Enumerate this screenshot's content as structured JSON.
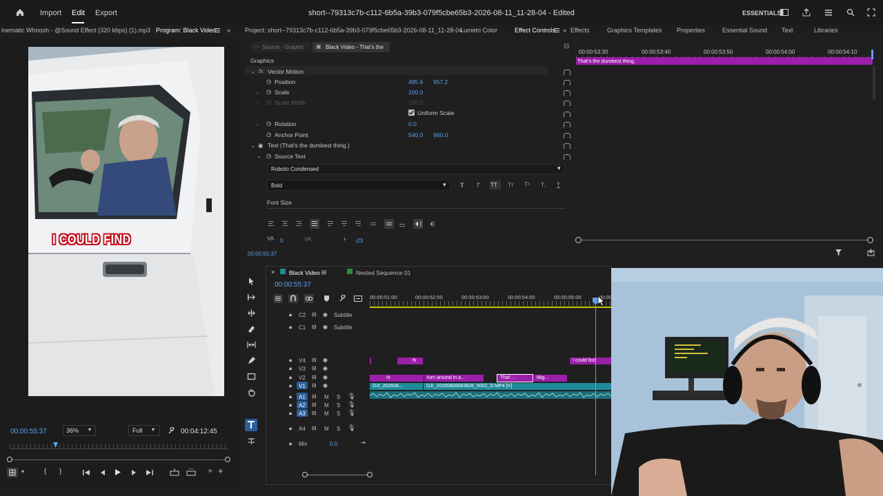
{
  "topbar": {
    "menu": [
      "Import",
      "Edit",
      "Export"
    ],
    "active_menu": "Edit",
    "title": "short--79313c7b-c112-6b5a-39b3-079f5cbe65b3-2026-08-11_11-28-04 - Edited",
    "workspace": "ESSENTIALS"
  },
  "panels": {
    "left_audio_tab": "inematic Whoosh - @Sound Effect (320 kbps) (1).mp3",
    "program_tab": "Program: Black Video",
    "project_tab": "Project: short--79313c7b-c112-6b5a-39b3-079f5cbe65b3-2026-08-11_11-28-04",
    "lumetri_tab": "Lumetri Color",
    "effect_controls_tab": "Effect Controls",
    "right_tabs": [
      "Effects",
      "Graphics Templates",
      "Properties",
      "Essential Sound",
      "Text",
      "Libraries"
    ]
  },
  "program": {
    "caption": "I COULD FIND",
    "timecode": "00:00:55:37",
    "zoom": "36%",
    "quality": "Full",
    "duration": "00:04:12:45",
    "playhead_fraction": 0.22
  },
  "effect_controls": {
    "source_tab": "Source - Graphic",
    "clip_tab": "Black Video - That's the",
    "section": "Graphics",
    "vector_motion": "Vector Motion",
    "position_label": "Position",
    "position_x": "495.6",
    "position_y": "957.2",
    "scale_label": "Scale",
    "scale_value": "100.0",
    "scale_width_label": "Scale Width",
    "scale_width_value": "100.0",
    "uniform_scale": "Uniform Scale",
    "rotation_label": "Rotation",
    "rotation_value": "0.0",
    "anchor_label": "Anchor Point",
    "anchor_x": "540.0",
    "anchor_y": "960.0",
    "text_layer": "Text (That's the dumbest thing.)",
    "source_text": "Source Text",
    "font": "Roboto Condensed",
    "font_style": "Bold",
    "font_size_label": "Font Size",
    "kerning_value": "0",
    "tracking_value": "-23",
    "timecode": "00:00:55:37",
    "tl_times": [
      "00:00:53:30",
      "00:00:53:40",
      "00:00:53:50",
      "00:00:54:00",
      "00:00:54:10"
    ],
    "tl_clip": "That's the dumbest thing."
  },
  "timeline": {
    "tab": "Black Video",
    "nested_tab": "Nested Sequence 01",
    "timecode": "00:00:55:37",
    "ruler": [
      "00:00:51:00",
      "00:00:52:00",
      "00:00:53:00",
      "00:00:54:00",
      "00:00:55:00",
      "00:00"
    ],
    "tracks": {
      "c2": "C2",
      "c1": "C1",
      "subtitle": "Subtitle",
      "v4": "V4",
      "v3": "V3",
      "v2": "V2",
      "v1": "V1",
      "a1": "A1",
      "a2": "A2",
      "a3": "A3",
      "a4": "A4",
      "m": "M",
      "s": "S",
      "mix": "Mix",
      "mix_value": "0.0"
    },
    "clips": {
      "fx": "fx",
      "i_could_find": "I could find",
      "turn_around": "turn around in a...",
      "thats": "That'...",
      "mig": "Mig...",
      "dji_a": "DJI_202608...",
      "dji_b": "DJI_20260808083826_0002_D.MP4 [V]"
    }
  },
  "colors": {
    "accent_blue": "#5da2f0",
    "clip_purple": "#9b1fa8",
    "video_teal": "#1f8a9a",
    "caption_red": "#c01020"
  }
}
